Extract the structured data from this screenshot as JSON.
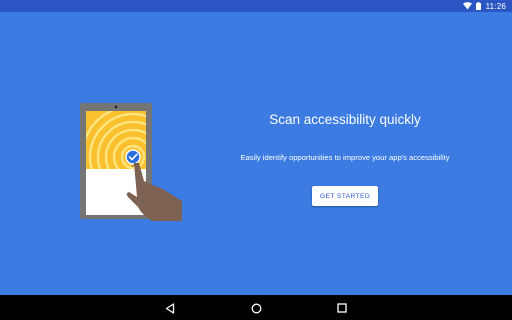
{
  "status_bar": {
    "time": "11:26",
    "icons": [
      "wifi-icon",
      "battery-icon"
    ]
  },
  "main": {
    "title": "Scan accessibility quickly",
    "subtitle": "Easily identify opportunities to improve your app's accessibility",
    "get_started_label": "GET STARTED",
    "illustration": "tablet-with-scan-and-hand"
  },
  "nav_bar": {
    "buttons": [
      "back-icon",
      "home-icon",
      "recents-icon"
    ]
  },
  "colors": {
    "background": "#3b7be2",
    "status_bar": "#2c56c3",
    "scan_yellow": "#fbc02d",
    "check_blue": "#2a6fdb",
    "button_text": "#2a5fcc"
  }
}
